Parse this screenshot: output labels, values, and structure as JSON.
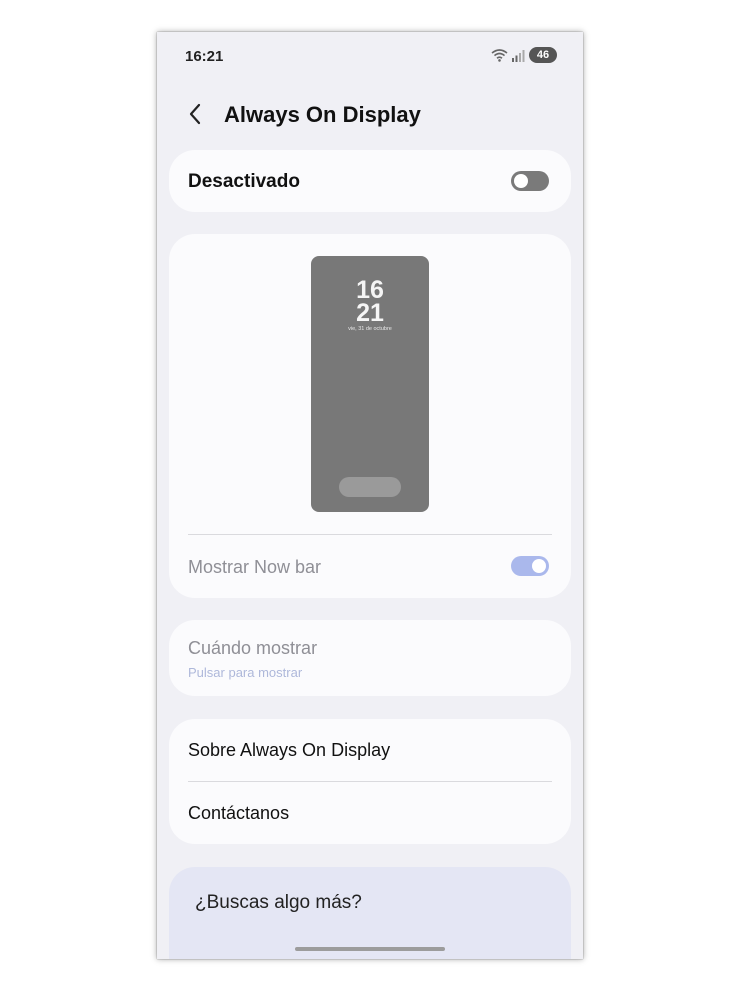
{
  "status_bar": {
    "time": "16:21",
    "battery": "46",
    "icons": [
      "wifi-icon",
      "signal-icon",
      "battery-icon"
    ]
  },
  "header": {
    "title": "Always On Display",
    "back_icon": "chevron-left-icon"
  },
  "master_switch": {
    "label": "Desactivado",
    "state": false
  },
  "preview": {
    "hour": "16",
    "minute": "21",
    "date": "vie, 31 de octubre",
    "now_bar_label": "Mostrar Now bar",
    "now_bar_state": true
  },
  "when_to_show": {
    "title": "Cuándo mostrar",
    "subtitle": "Pulsar para mostrar"
  },
  "info": {
    "items": [
      {
        "label": "Sobre Always On Display"
      },
      {
        "label": "Contáctanos"
      }
    ]
  },
  "suggestions": {
    "title": "¿Buscas algo más?"
  },
  "colors": {
    "background": "#f0f0f5",
    "card": "#fbfbfd",
    "toggle_off": "#7a7a7a",
    "toggle_on": "#aab8ec",
    "suggestion_card": "#e4e6f4"
  }
}
